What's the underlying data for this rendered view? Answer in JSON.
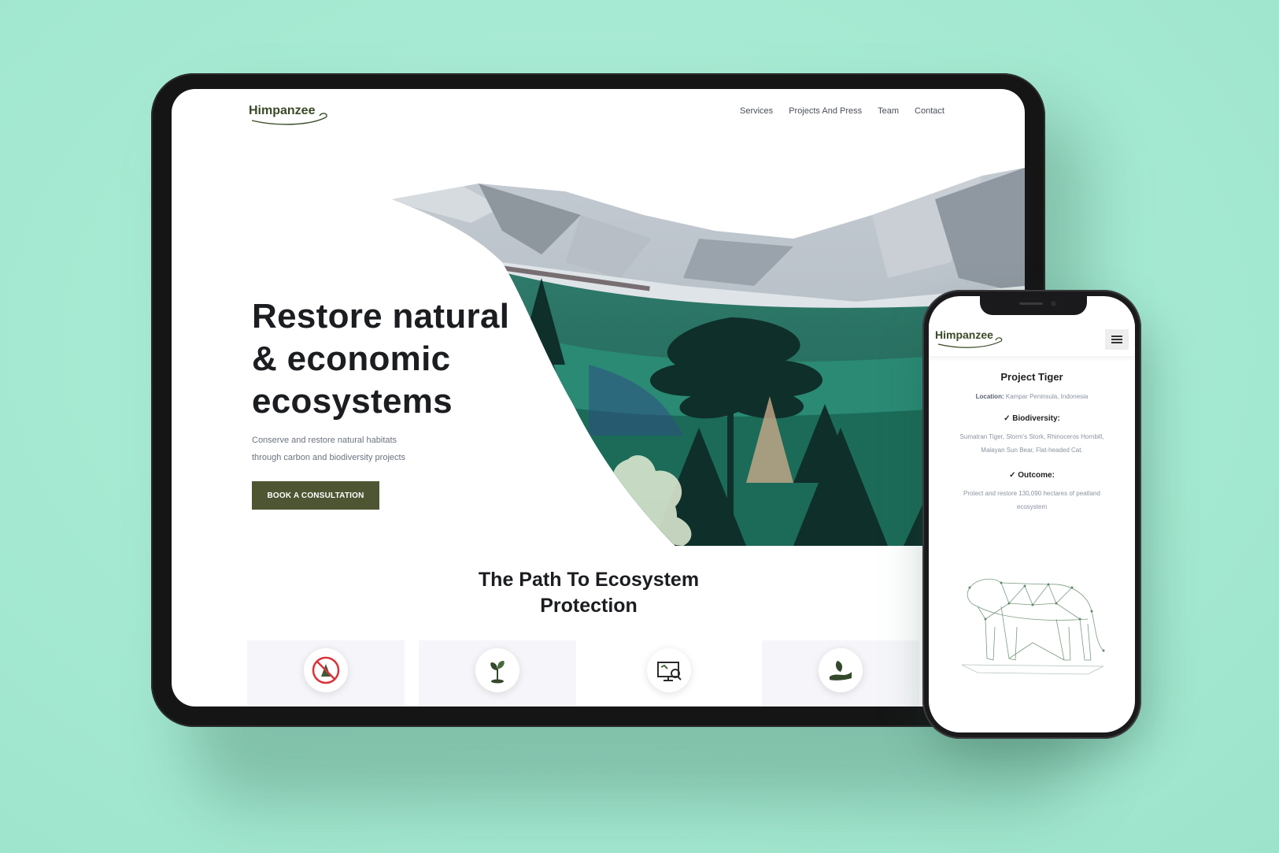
{
  "background_color": "#a8ecd5",
  "brand": {
    "name": "Himpanzee",
    "accent": "#4d5532"
  },
  "tablet": {
    "nav": [
      "Services",
      "Projects And Press",
      "Team",
      "Contact"
    ],
    "hero": {
      "title_lines": [
        "Restore natural",
        "& economic",
        "ecosystems"
      ],
      "subtitle_lines": [
        "Conserve and restore natural habitats",
        "through carbon and biodiversity projects"
      ],
      "cta": "BOOK A CONSULTATION"
    },
    "path_section": {
      "title_lines": [
        "The Path To Ecosystem",
        "Protection"
      ],
      "cards": [
        {
          "icon": "no-deforestation-icon"
        },
        {
          "icon": "sprouting-plant-icon"
        },
        {
          "icon": "monitoring-screen-icon"
        },
        {
          "icon": "hand-leaf-icon"
        }
      ]
    }
  },
  "phone": {
    "menu_icon": "hamburger-menu-icon",
    "project": {
      "title": "Project Tiger",
      "location_label": "Location:",
      "location_value": "Kampar Peninsula, Indonesia",
      "biodiversity_label": "Biodiversity:",
      "biodiversity_lines": [
        "Sumatran Tiger, Storm's Stork, Rhinoceros Hornbill,",
        "Malayan Sun Bear, Flat-headed Cat."
      ],
      "outcome_label": "Outcome:",
      "outcome_lines": [
        "Protect and restore 130,090 hectares of peatland",
        "ecosystem"
      ],
      "illustration": "tiger-wireframe-illustration"
    }
  }
}
